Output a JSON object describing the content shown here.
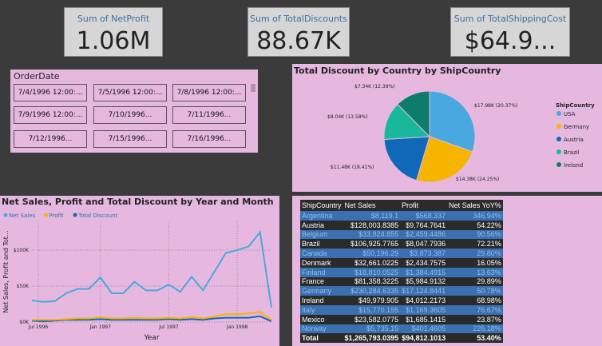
{
  "cards": [
    {
      "label": "Sum of NetProfit",
      "value": "1.06M"
    },
    {
      "label": "Sum of TotalDiscounts",
      "value": "88.67K"
    },
    {
      "label": "Sum of TotalShippingCost",
      "value": "$64.9..."
    }
  ],
  "slicer": {
    "title": "OrderDate",
    "items": [
      "7/4/1996 12:00:...",
      "7/5/1996 12:00:...",
      "7/8/1996 12:00:...",
      "7/9/1996 12:00:...",
      "7/10/1996...",
      "7/11/1996...",
      "7/12/1996...",
      "7/15/1996...",
      "7/16/1996..."
    ]
  },
  "pie": {
    "title": "Total Discount by Country by ShipCountry",
    "legend_title": "ShipCountry",
    "slices": [
      {
        "name": "USA",
        "value": 17.98,
        "label": "$17.98K (20.37%)",
        "color": "#4aa8e0"
      },
      {
        "name": "Germany",
        "value": 14.38,
        "label": "$14.38K (24.25%)",
        "color": "#f5b400"
      },
      {
        "name": "Austria",
        "value": 11.48,
        "label": "$11.48K (18.41%)",
        "color": "#1068b8"
      },
      {
        "name": "Brazil",
        "value": 8.04,
        "label": "$8.04K (13.58%)",
        "color": "#1ab89a"
      },
      {
        "name": "Ireland",
        "value": 7.34,
        "label": "$7.34K (12.39%)",
        "color": "#0e7c6a"
      }
    ]
  },
  "line_chart": {
    "title": "Net Sales, Profit and Total Discount by Year and Month",
    "ylabel": "Net Sales, Profit and Tot...",
    "xlabel": "Year"
  },
  "chart_data": {
    "type": "line",
    "title": "Net Sales, Profit and Total Discount by Year and Month",
    "xlabel": "Year",
    "ylabel": "Net Sales, Profit and Tot...",
    "x_ticks": [
      "Jul 1996",
      "Jan 1997",
      "Jul 1997",
      "Jan 1998"
    ],
    "y_ticks": [
      "$0K",
      "$50K",
      "$100K"
    ],
    "ylim": [
      0,
      140
    ],
    "grid": true,
    "legend_position": "top-left",
    "series": [
      {
        "name": "Net Sales",
        "color": "#4aa8e0",
        "values": [
          30,
          28,
          29,
          40,
          46,
          46,
          62,
          40,
          40,
          56,
          44,
          44,
          52,
          42,
          63,
          44,
          70,
          96,
          100,
          105,
          125,
          20
        ]
      },
      {
        "name": "Profit",
        "color": "#f5b400",
        "values": [
          3,
          3,
          3,
          4,
          5,
          5,
          7,
          5,
          5,
          6,
          5,
          5,
          6,
          5,
          7,
          5,
          8,
          11,
          11,
          12,
          14,
          3
        ]
      },
      {
        "name": "Total Discount",
        "color": "#1068b8",
        "values": [
          2,
          1,
          2,
          3,
          3,
          3,
          4,
          3,
          3,
          3,
          3,
          3,
          4,
          3,
          4,
          3,
          5,
          6,
          6,
          6,
          8,
          1
        ]
      }
    ]
  },
  "matrix": {
    "headers": [
      "ShipCountry",
      "Net Sales",
      "Profit",
      "Net Sales YoY%"
    ],
    "rows": [
      [
        "Argentina",
        "$8,119.1",
        "$568.337",
        "346.94%"
      ],
      [
        "Austria",
        "$128,003.8385",
        "$9,764.7641",
        "54.22%"
      ],
      [
        "Belgium",
        "$33,824.855",
        "$2,459.4486",
        "90.56%"
      ],
      [
        "Brazil",
        "$106,925.7765",
        "$8,047.7936",
        "72.21%"
      ],
      [
        "Canada",
        "$50,196.29",
        "$3,873.387",
        "29.80%"
      ],
      [
        "Denmark",
        "$32,661.0225",
        "$2,434.7575",
        "16.05%"
      ],
      [
        "Finland",
        "$18,810.0525",
        "$1,384.4915",
        "13.63%"
      ],
      [
        "France",
        "$81,358.3225",
        "$5,984.9132",
        "29.89%"
      ],
      [
        "Germany",
        "$230,284.6335",
        "$17,124.8441",
        "50.78%"
      ],
      [
        "Ireland",
        "$49,979.905",
        "$4,012.2173",
        "68.98%"
      ],
      [
        "Italy",
        "$15,770.155",
        "$1,169.3605",
        "76.67%"
      ],
      [
        "Mexico",
        "$23,582.0775",
        "$1,685.1415",
        "23.87%"
      ],
      [
        "Norway",
        "$5,735.15",
        "$401.4605",
        "226.18%"
      ]
    ],
    "total": [
      "Total",
      "$1,265,793.0395",
      "$94,812.1013",
      "53.40%"
    ]
  }
}
